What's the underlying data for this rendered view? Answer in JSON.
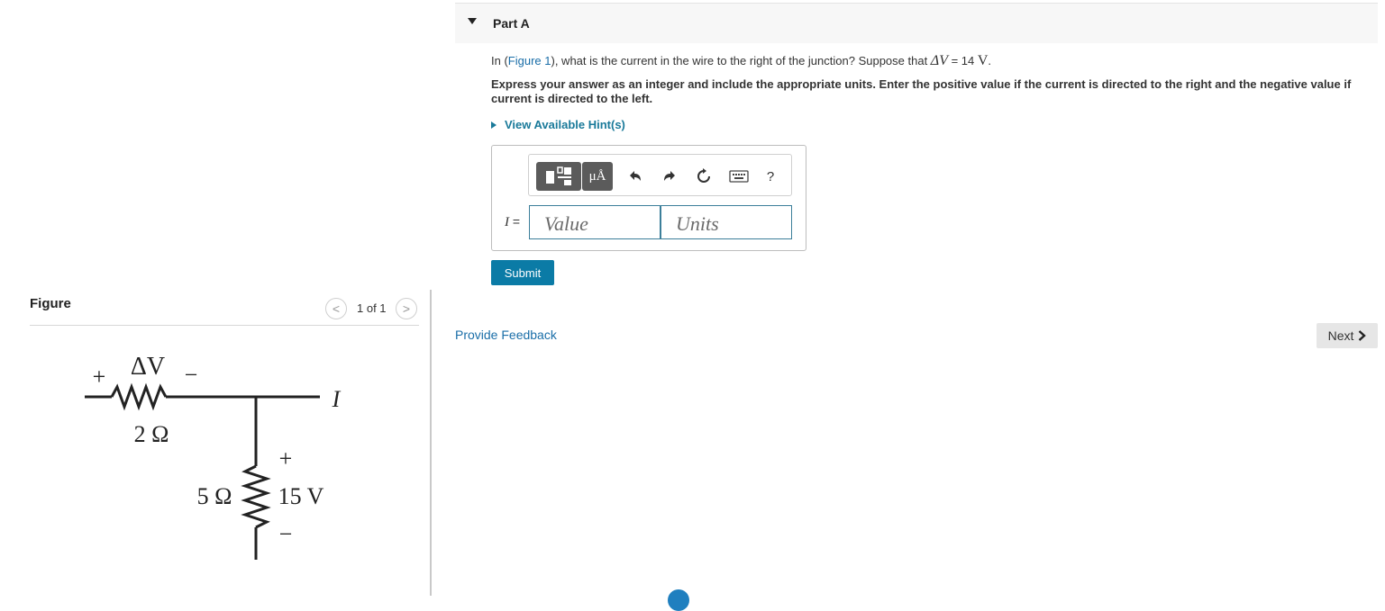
{
  "figure": {
    "title": "Figure",
    "prev_symbol": "<",
    "next_symbol": ">",
    "counter": "1 of 1",
    "circuit": {
      "voltage_top_plus": "+",
      "voltage_top_label": "ΔV",
      "voltage_top_minus": "−",
      "resistor_top_label": "2 Ω",
      "current_label": "I",
      "resistor_bottom_label": "5 Ω",
      "battery_plus": "+",
      "battery_label": "15 V",
      "battery_minus": "−"
    }
  },
  "part": {
    "title": "Part A"
  },
  "question": {
    "prefix": "In (",
    "figure_link": "Figure 1",
    "middle": "), what is the current in the wire to the right of the junction? Suppose that ",
    "math_var": "ΔV",
    "equals": " = 14 ",
    "unit": "V",
    "end": "."
  },
  "instructions": "Express your answer as an integer and include the appropriate units. Enter the positive value if the current is directed to the right and the negative value if current is directed to the left.",
  "hint": {
    "label": "View Available Hint(s)"
  },
  "answer": {
    "toolbar": {
      "units_button": "μÅ",
      "help": "?"
    },
    "variable": "I",
    "equals": " =",
    "value_placeholder": "Value",
    "units_placeholder": "Units"
  },
  "submit_label": "Submit",
  "feedback_label": "Provide Feedback",
  "next_label": "Next",
  "colors": {
    "accent": "#0b7ba6",
    "link": "#1a6ea8",
    "input_border": "#3c7f9a"
  }
}
